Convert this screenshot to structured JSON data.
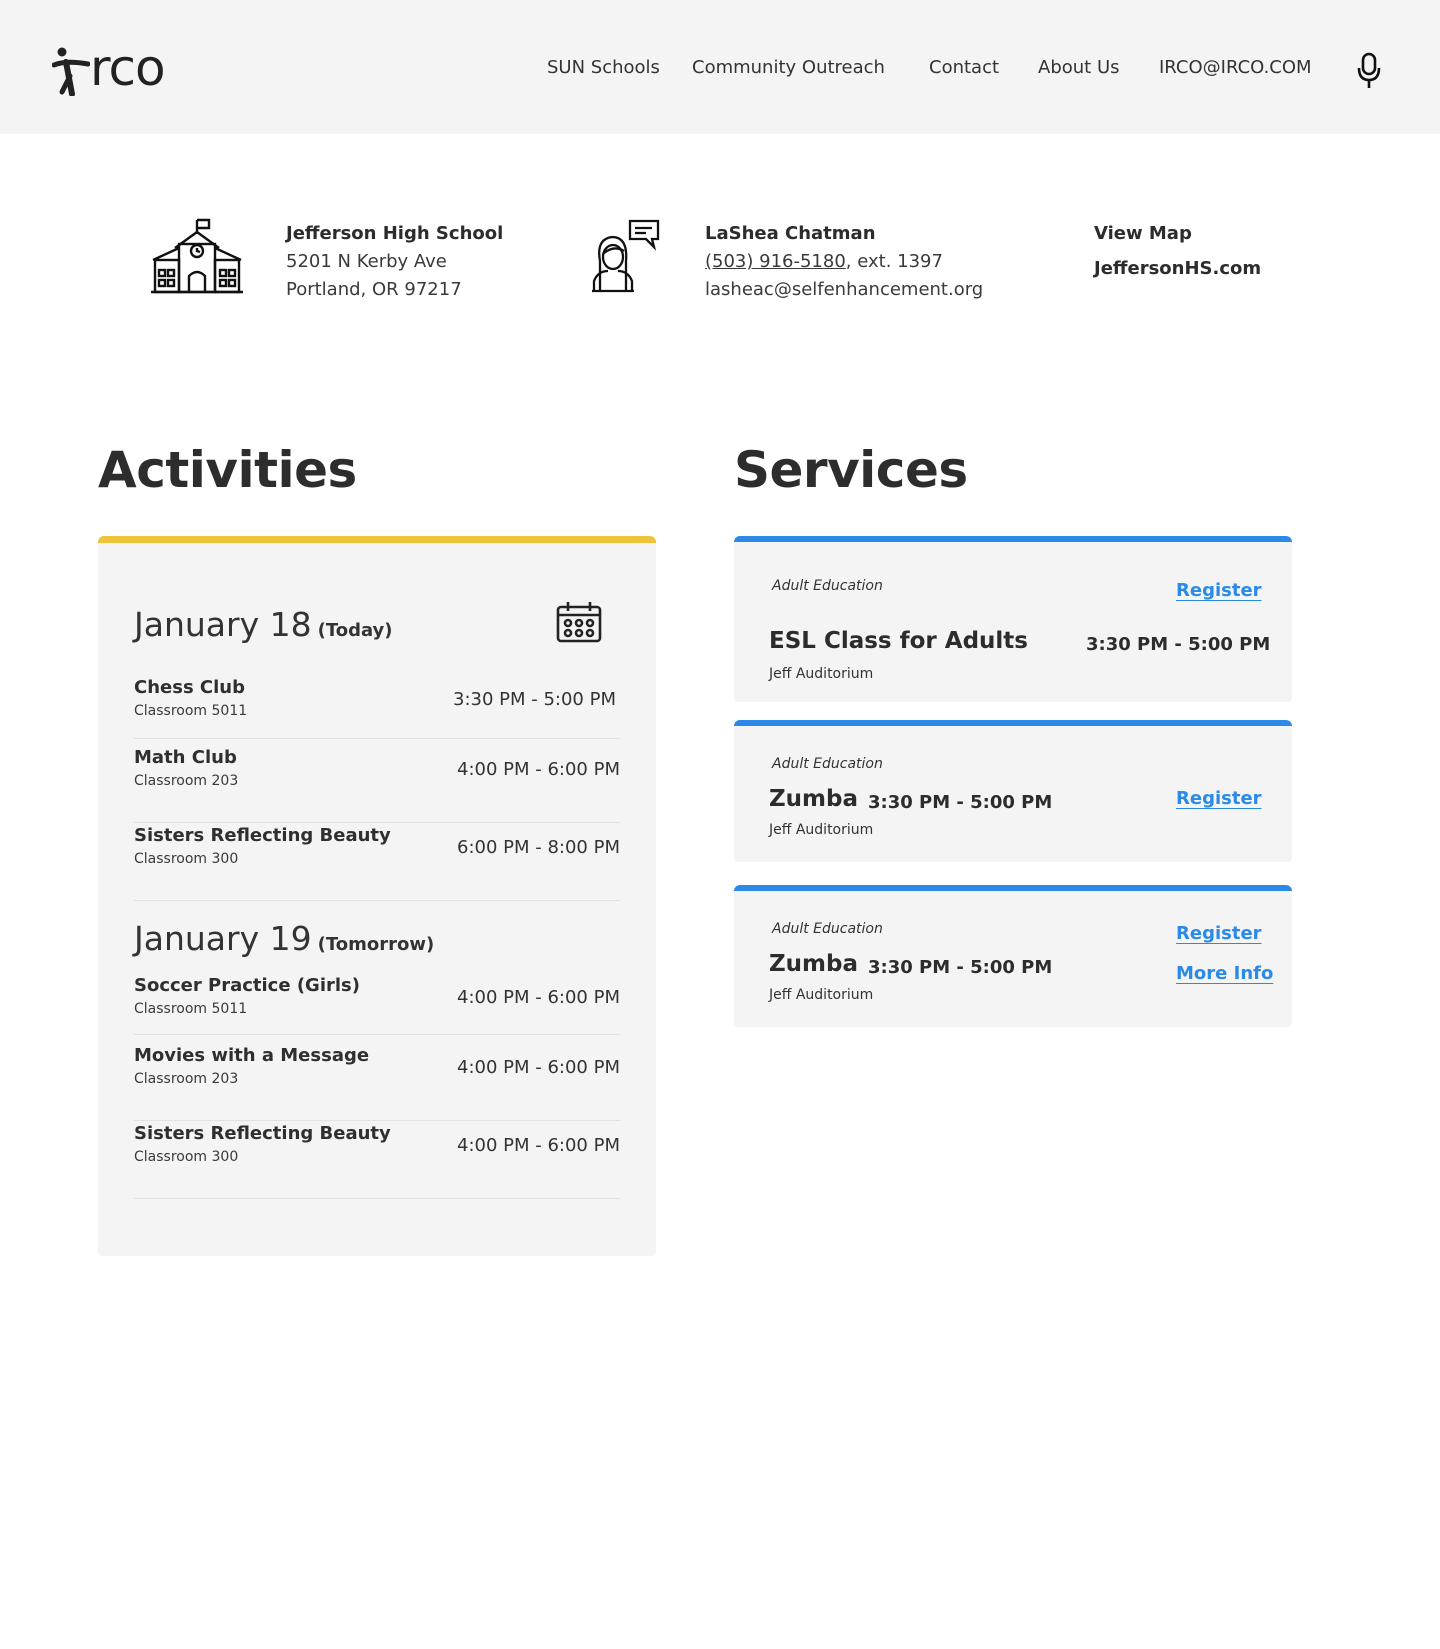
{
  "header": {
    "logo_text": "rco",
    "nav": [
      {
        "label": "SUN Schools"
      },
      {
        "label": "Community Outreach"
      },
      {
        "label": "Contact"
      },
      {
        "label": "About Us"
      },
      {
        "label": "IRCO@IRCO.COM"
      }
    ],
    "mic_icon": "microphone-icon"
  },
  "school": {
    "icon": "school-building-icon",
    "name": "Jefferson High School",
    "address_line1": "5201 N Kerby Ave",
    "address_line2": "Portland, OR 97217"
  },
  "contact": {
    "icon": "person-chat-icon",
    "name": "LaShea Chatman",
    "phone": "(503) 916-5180",
    "ext": ", ext. 1397",
    "email": "lasheac@selfenhancement.org"
  },
  "links": {
    "view_map": "View Map",
    "website": "JeffersonHS.com"
  },
  "activities": {
    "title": "Activities",
    "accent": "#f0c43a",
    "days": [
      {
        "date": "January 18",
        "note": "(Today)",
        "items": [
          {
            "name": "Chess Club",
            "room": "Classroom 5011",
            "time": "3:30 PM - 5:00 PM"
          },
          {
            "name": "Math Club",
            "room": "Classroom 203",
            "time": "4:00 PM - 6:00 PM"
          },
          {
            "name": "Sisters Reflecting Beauty",
            "room": "Classroom 300",
            "time": "6:00 PM - 8:00 PM"
          }
        ]
      },
      {
        "date": "January 19",
        "note": "(Tomorrow)",
        "items": [
          {
            "name": "Soccer Practice (Girls)",
            "room": "Classroom 5011",
            "time": "4:00 PM - 6:00 PM"
          },
          {
            "name": "Movies with a Message",
            "room": "Classroom 203",
            "time": "4:00 PM - 6:00 PM"
          },
          {
            "name": "Sisters Reflecting Beauty",
            "room": "Classroom 300",
            "time": "4:00 PM - 6:00 PM"
          }
        ]
      }
    ],
    "calendar_icon": "calendar-icon"
  },
  "services": {
    "title": "Services",
    "accent": "#2b8ae8",
    "items": [
      {
        "category": "Adult Education",
        "title": "ESL Class for Adults",
        "time": "3:30 PM - 5:00 PM",
        "location": "Jeff Auditorium",
        "register": "Register"
      },
      {
        "category": "Adult Education",
        "title": "Zumba",
        "time": "3:30 PM - 5:00 PM",
        "location": "Jeff Auditorium",
        "register": "Register"
      },
      {
        "category": "Adult Education",
        "title": "Zumba",
        "time": "3:30 PM - 5:00 PM",
        "location": "Jeff Auditorium",
        "register": "Register",
        "more_info": "More Info"
      }
    ]
  }
}
